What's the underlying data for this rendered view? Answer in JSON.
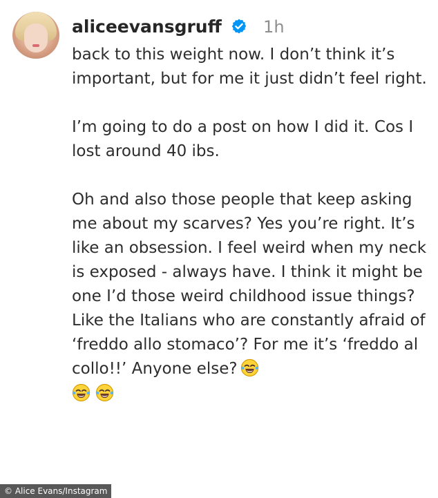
{
  "comment": {
    "avatar_icon": "profile-photo",
    "username": "aliceevansgruff",
    "verified_icon": "verified-badge-icon",
    "timestamp": "1h",
    "paragraphs": [
      "back to this weight now. I don’t think it’s important, but for me it just didn’t feel right.",
      "I’m going to do a post on how I did it. Cos I lost around 40 ibs.",
      "Oh and also those people that keep asking me about my scarves? Yes you’re right. It’s like an obsession. I feel weird when my neck is exposed - always have. I think it might be one I’d those weird childhood issue things? Like the Italians who are constantly afraid of ‘freddo allo stomaco’? For me it’s ‘freddo al collo!!’ Anyone else?"
    ],
    "emojis": [
      "face-with-tears-of-joy",
      "face-with-tears-of-joy",
      "face-with-tears-of-joy"
    ]
  },
  "credit": "© Alice Evans/Instagram",
  "colors": {
    "verified": "#0095f6",
    "timestamp": "#8e8e8e",
    "text": "#2d2d2d"
  }
}
